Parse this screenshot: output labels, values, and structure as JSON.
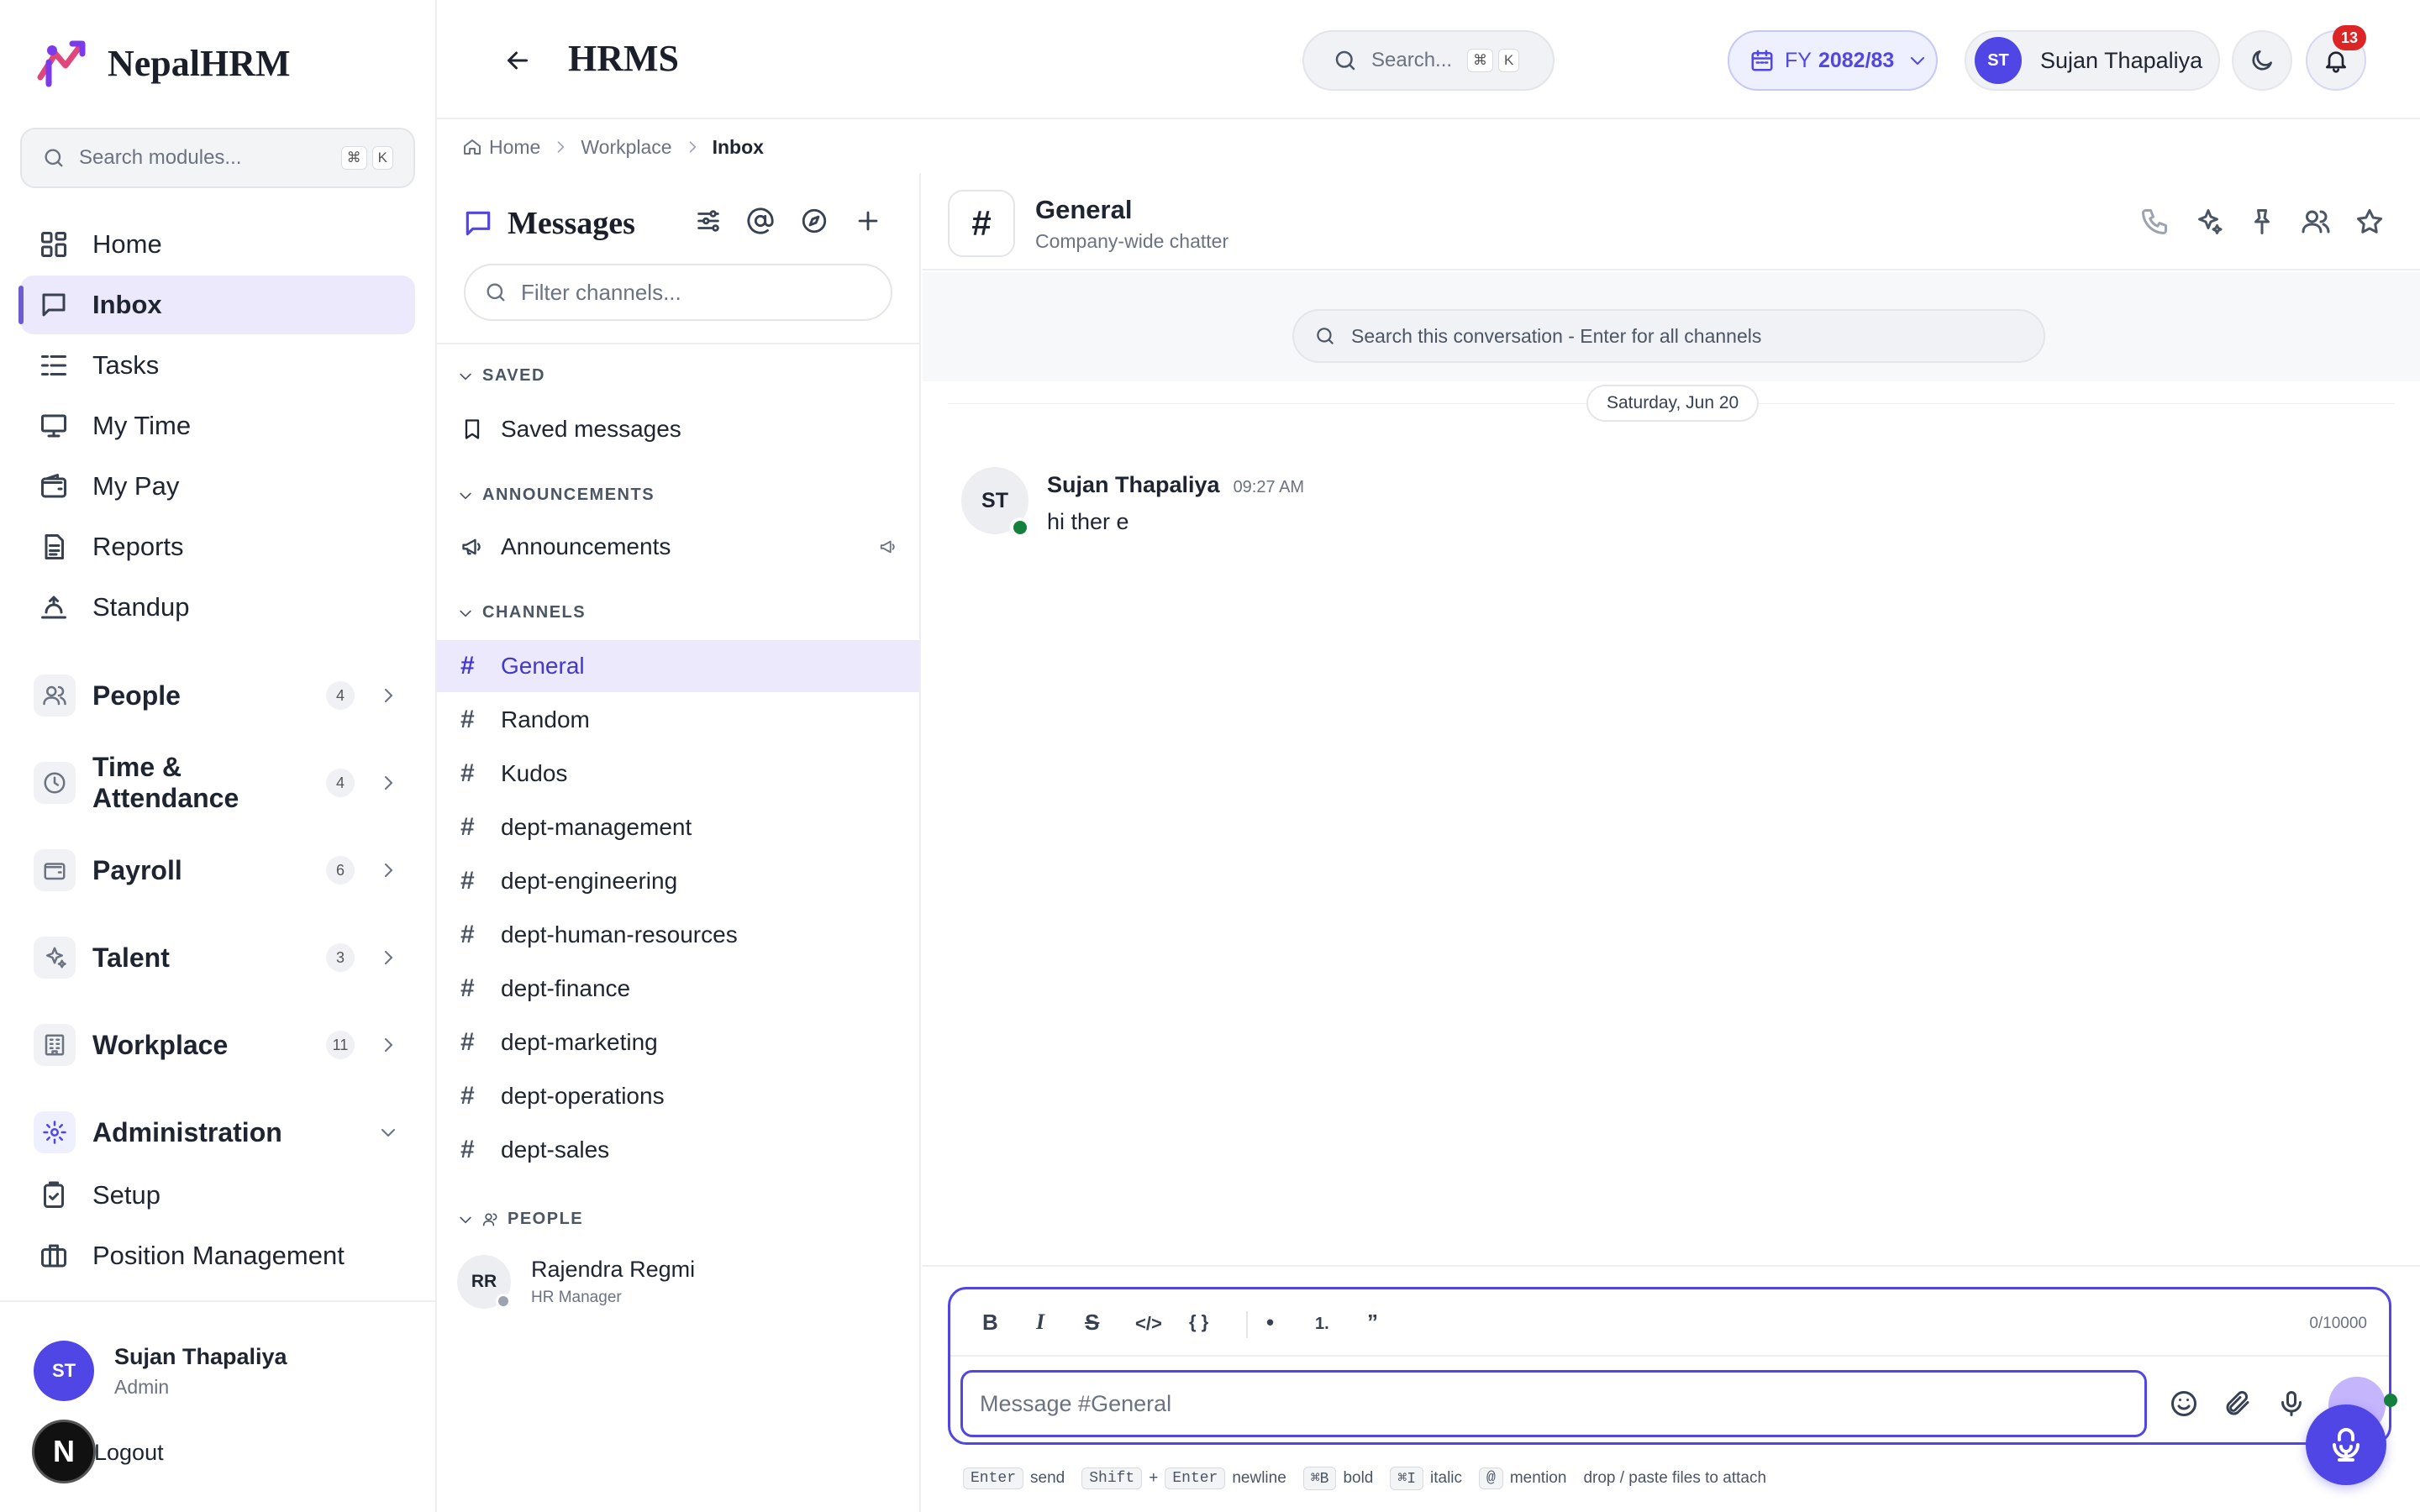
{
  "brand": {
    "name": "NepalHRM"
  },
  "sidebar": {
    "search_placeholder": "Search modules...",
    "shortcut": [
      "⌘",
      "K"
    ],
    "items": [
      {
        "label": "Home",
        "icon": "grid-icon"
      },
      {
        "label": "Inbox",
        "icon": "chat-icon"
      },
      {
        "label": "Tasks",
        "icon": "list-icon"
      },
      {
        "label": "My Time",
        "icon": "monitor-icon"
      },
      {
        "label": "My Pay",
        "icon": "wallet-icon"
      },
      {
        "label": "Reports",
        "icon": "document-icon"
      },
      {
        "label": "Standup",
        "icon": "sunrise-icon"
      }
    ],
    "groups": [
      {
        "label": "People",
        "count": "4"
      },
      {
        "label": "Time & Attendance",
        "count": "4"
      },
      {
        "label": "Payroll",
        "count": "6"
      },
      {
        "label": "Talent",
        "count": "3"
      },
      {
        "label": "Workplace",
        "count": "11"
      }
    ],
    "admin": {
      "label": "Administration",
      "items": [
        "Setup",
        "Position Management"
      ]
    },
    "user": {
      "initials": "ST",
      "name": "Sujan Thapaliya",
      "role": "Admin",
      "logout": "Logout",
      "badge": "N"
    }
  },
  "header": {
    "title": "HRMS",
    "search_placeholder": "Search...",
    "shortcut": [
      "⌘",
      "K"
    ],
    "fy_prefix": "FY",
    "fy_value": "2082/83",
    "user_initials": "ST",
    "user_name": "Sujan Thapaliya",
    "notif_count": "13"
  },
  "breadcrumb": [
    "Home",
    "Workplace",
    "Inbox"
  ],
  "channels_panel": {
    "title": "Messages",
    "filter_placeholder": "Filter channels...",
    "sections": {
      "saved": "SAVED",
      "announcements": "ANNOUNCEMENTS",
      "channels": "CHANNELS",
      "people": "PEOPLE"
    },
    "saved_item": "Saved messages",
    "announcement_item": "Announcements",
    "channels": [
      "General",
      "Random",
      "Kudos",
      "dept-management",
      "dept-engineering",
      "dept-human-resources",
      "dept-finance",
      "dept-marketing",
      "dept-operations",
      "dept-sales"
    ],
    "people": [
      {
        "initials": "RR",
        "name": "Rajendra Regmi",
        "role": "HR Manager"
      }
    ]
  },
  "chat": {
    "channel_name": "General",
    "channel_desc": "Company-wide chatter",
    "search_placeholder": "Search this conversation - Enter for all channels",
    "date_label": "Saturday, Jun 20",
    "messages": [
      {
        "initials": "ST",
        "author": "Sujan Thapaliya",
        "time": "09:27 AM",
        "text": "hi ther e"
      }
    ],
    "composer": {
      "placeholder": "Message #General",
      "char_count": "0/10000",
      "toolbar": [
        "B",
        "I",
        "S",
        "</>",
        "{ }",
        "•",
        "1.",
        "”"
      ]
    },
    "hints": [
      {
        "keys": [
          "Enter"
        ],
        "text": "send"
      },
      {
        "keys": [
          "Shift",
          "Enter"
        ],
        "text": "newline",
        "joiner": "+"
      },
      {
        "keys": [
          "⌘B"
        ],
        "text": "bold"
      },
      {
        "keys": [
          "⌘I"
        ],
        "text": "italic"
      },
      {
        "keys": [
          "@"
        ],
        "text": "mention"
      }
    ],
    "hint_tail": "drop / paste files to attach"
  },
  "colors": {
    "accent": "#4f46e5",
    "active_bg": "#ebe9fb",
    "online": "#16a34a",
    "notif": "#dc2626"
  }
}
